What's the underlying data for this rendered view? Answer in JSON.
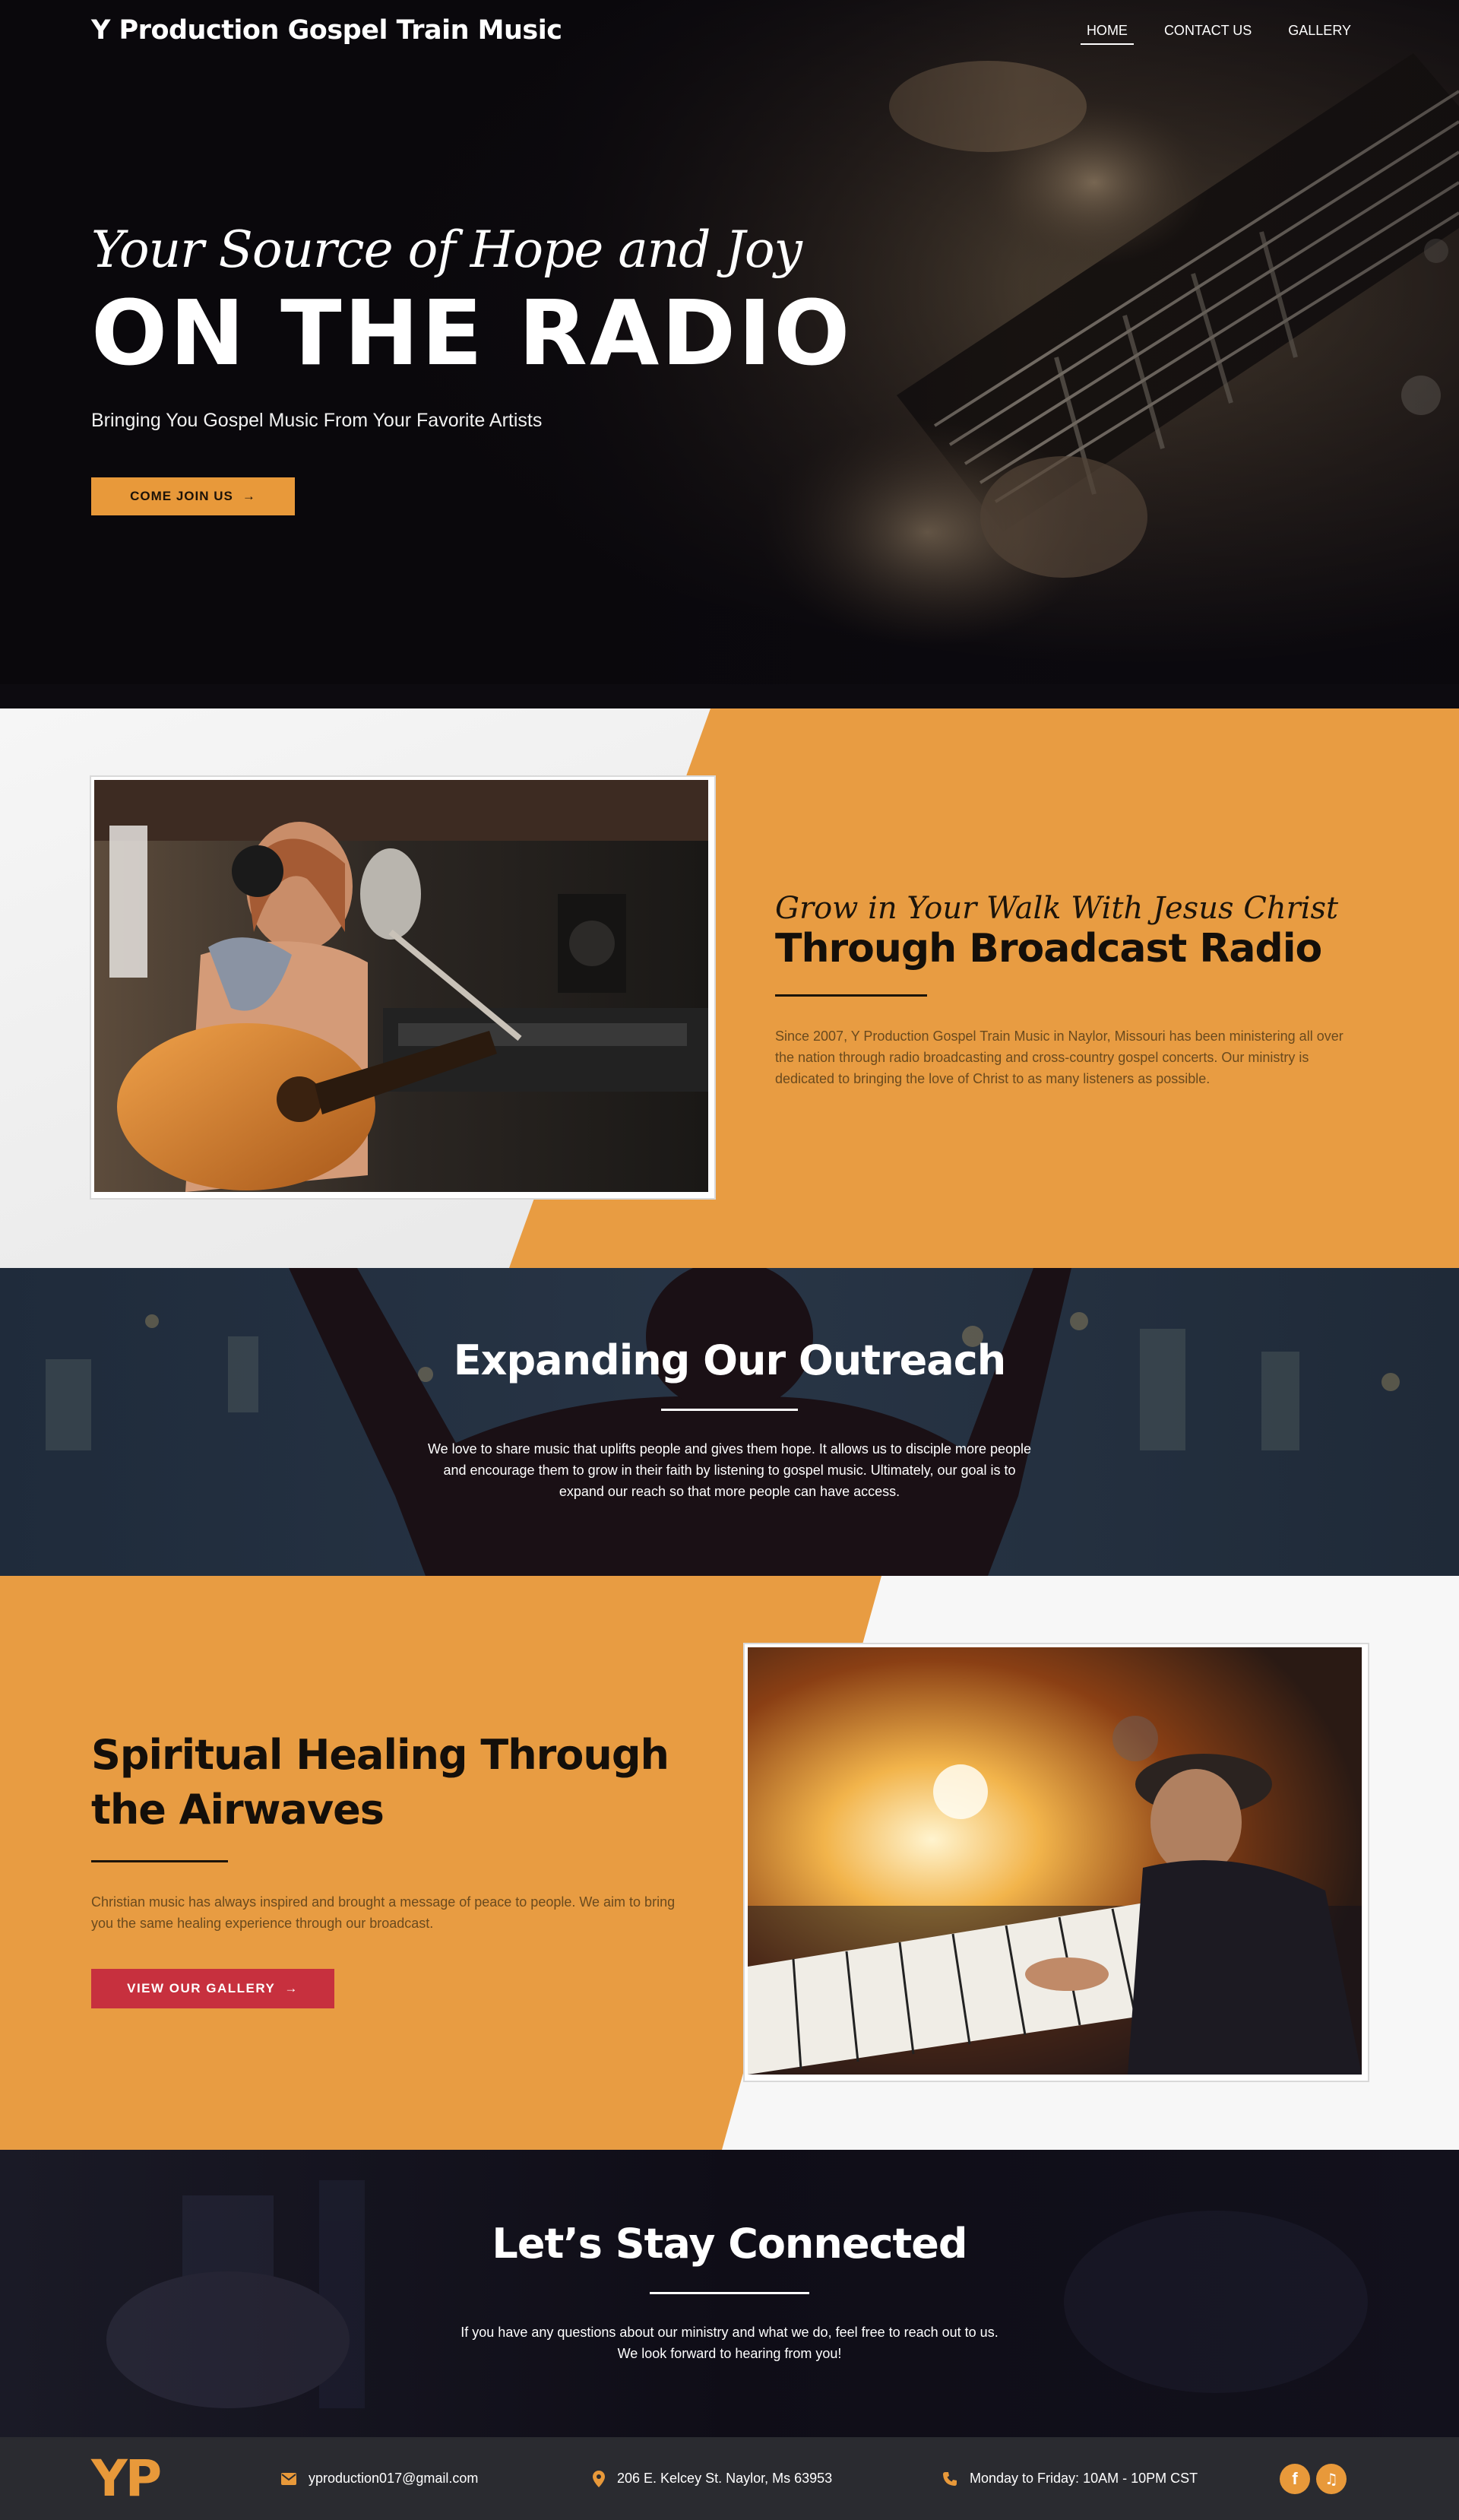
{
  "header": {
    "site_title": "Y Production Gospel Train Music",
    "nav": [
      {
        "label": "HOME",
        "active": true
      },
      {
        "label": "CONTACT US",
        "active": false
      },
      {
        "label": "GALLERY",
        "active": false
      }
    ]
  },
  "hero": {
    "script_line": "Your Source of Hope and Joy",
    "title": "ON THE RADIO",
    "subtitle": "Bringing You Gospel Music From Your Favorite Artists",
    "cta_label": "COME JOIN US",
    "cta_arrow": "→"
  },
  "broadcast": {
    "script_line": "Grow in Your Walk With Jesus Christ",
    "heading": "Through Broadcast Radio",
    "body": "Since 2007, Y Production Gospel Train Music in Naylor, Missouri has been ministering all over the nation through radio broadcasting and cross-country gospel concerts. Our ministry is dedicated to bringing the love of Christ to as many listeners as possible."
  },
  "outreach": {
    "heading": "Expanding Our Outreach",
    "body": "We love to share music that uplifts people and gives them hope. It allows us to disciple more people and encourage them to grow in their faith by listening to gospel music. Ultimately, our goal is to expand our reach so that more people can have access."
  },
  "healing": {
    "heading_line1": "Spiritual Healing Through",
    "heading_line2": "the Airwaves",
    "body": "Christian music has always inspired and brought a message of peace to people. We aim to bring you the same healing experience through our broadcast.",
    "cta_label": "VIEW OUR GALLERY",
    "cta_arrow": "→"
  },
  "connect": {
    "heading": "Let’s Stay Connected",
    "body": "If you have any questions about our ministry and what we do, feel free to reach out to us. We look forward to hearing from you!"
  },
  "footer": {
    "logo": "YP",
    "email": "yproduction017@gmail.com",
    "address": "206 E. Kelcey St. Naylor, Ms 63953",
    "hours": "Monday to Friday: 10AM - 10PM CST",
    "social": [
      {
        "icon": "facebook-icon",
        "label": "f"
      },
      {
        "icon": "music-note-icon",
        "label": "♫"
      }
    ]
  },
  "colors": {
    "accent_orange": "#e8993a",
    "button_red": "#c7303e",
    "dark": "#0c0a0f",
    "footer_bg": "#2a2b30"
  }
}
